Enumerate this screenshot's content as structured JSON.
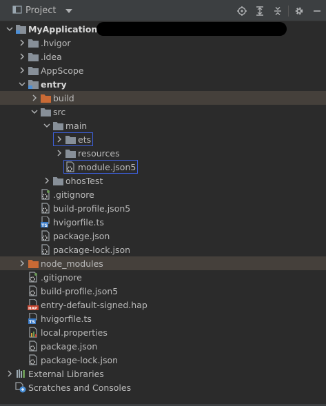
{
  "panel": {
    "title": "Project"
  },
  "toolbar": [
    "locate-icon",
    "expand-all-icon",
    "collapse-all-icon",
    "settings-icon",
    "hide-icon"
  ],
  "tree": [
    {
      "label": "MyApplication",
      "depth": 0,
      "arrow": "down",
      "icon": "module",
      "bold": true,
      "redacted": true
    },
    {
      "label": ".hvigor",
      "depth": 1,
      "arrow": "right",
      "icon": "folder"
    },
    {
      "label": ".idea",
      "depth": 1,
      "arrow": "right",
      "icon": "folder"
    },
    {
      "label": "AppScope",
      "depth": 1,
      "arrow": "right",
      "icon": "folder"
    },
    {
      "label": "entry",
      "depth": 1,
      "arrow": "down",
      "icon": "module",
      "bold": true
    },
    {
      "label": "build",
      "depth": 2,
      "arrow": "right",
      "icon": "folder-orange",
      "highlight": true
    },
    {
      "label": "src",
      "depth": 2,
      "arrow": "down",
      "icon": "folder"
    },
    {
      "label": "main",
      "depth": 3,
      "arrow": "down",
      "icon": "folder"
    },
    {
      "label": "ets",
      "depth": 4,
      "arrow": "right",
      "icon": "folder",
      "boxed": true
    },
    {
      "label": "resources",
      "depth": 4,
      "arrow": "right",
      "icon": "folder"
    },
    {
      "label": "module.json5",
      "depth": 4,
      "arrow": "none",
      "icon": "json",
      "boxed": true
    },
    {
      "label": "ohosTest",
      "depth": 3,
      "arrow": "right",
      "icon": "folder"
    },
    {
      "label": ".gitignore",
      "depth": 2,
      "arrow": "none",
      "icon": "gitignore"
    },
    {
      "label": "build-profile.json5",
      "depth": 2,
      "arrow": "none",
      "icon": "json"
    },
    {
      "label": "hvigorfile.ts",
      "depth": 2,
      "arrow": "none",
      "icon": "ts"
    },
    {
      "label": "package.json",
      "depth": 2,
      "arrow": "none",
      "icon": "json"
    },
    {
      "label": "package-lock.json",
      "depth": 2,
      "arrow": "none",
      "icon": "json"
    },
    {
      "label": "node_modules",
      "depth": 1,
      "arrow": "right",
      "icon": "folder-orange",
      "highlight": true
    },
    {
      "label": ".gitignore",
      "depth": 1,
      "arrow": "none",
      "icon": "gitignore"
    },
    {
      "label": "build-profile.json5",
      "depth": 1,
      "arrow": "none",
      "icon": "json"
    },
    {
      "label": "entry-default-signed.hap",
      "depth": 1,
      "arrow": "none",
      "icon": "hap"
    },
    {
      "label": "hvigorfile.ts",
      "depth": 1,
      "arrow": "none",
      "icon": "ts"
    },
    {
      "label": "local.properties",
      "depth": 1,
      "arrow": "none",
      "icon": "properties"
    },
    {
      "label": "package.json",
      "depth": 1,
      "arrow": "none",
      "icon": "json"
    },
    {
      "label": "package-lock.json",
      "depth": 1,
      "arrow": "none",
      "icon": "json"
    },
    {
      "label": "External Libraries",
      "depth": 0,
      "arrow": "right",
      "icon": "library"
    },
    {
      "label": "Scratches and Consoles",
      "depth": 0,
      "arrow": "none",
      "icon": "scratch"
    }
  ]
}
